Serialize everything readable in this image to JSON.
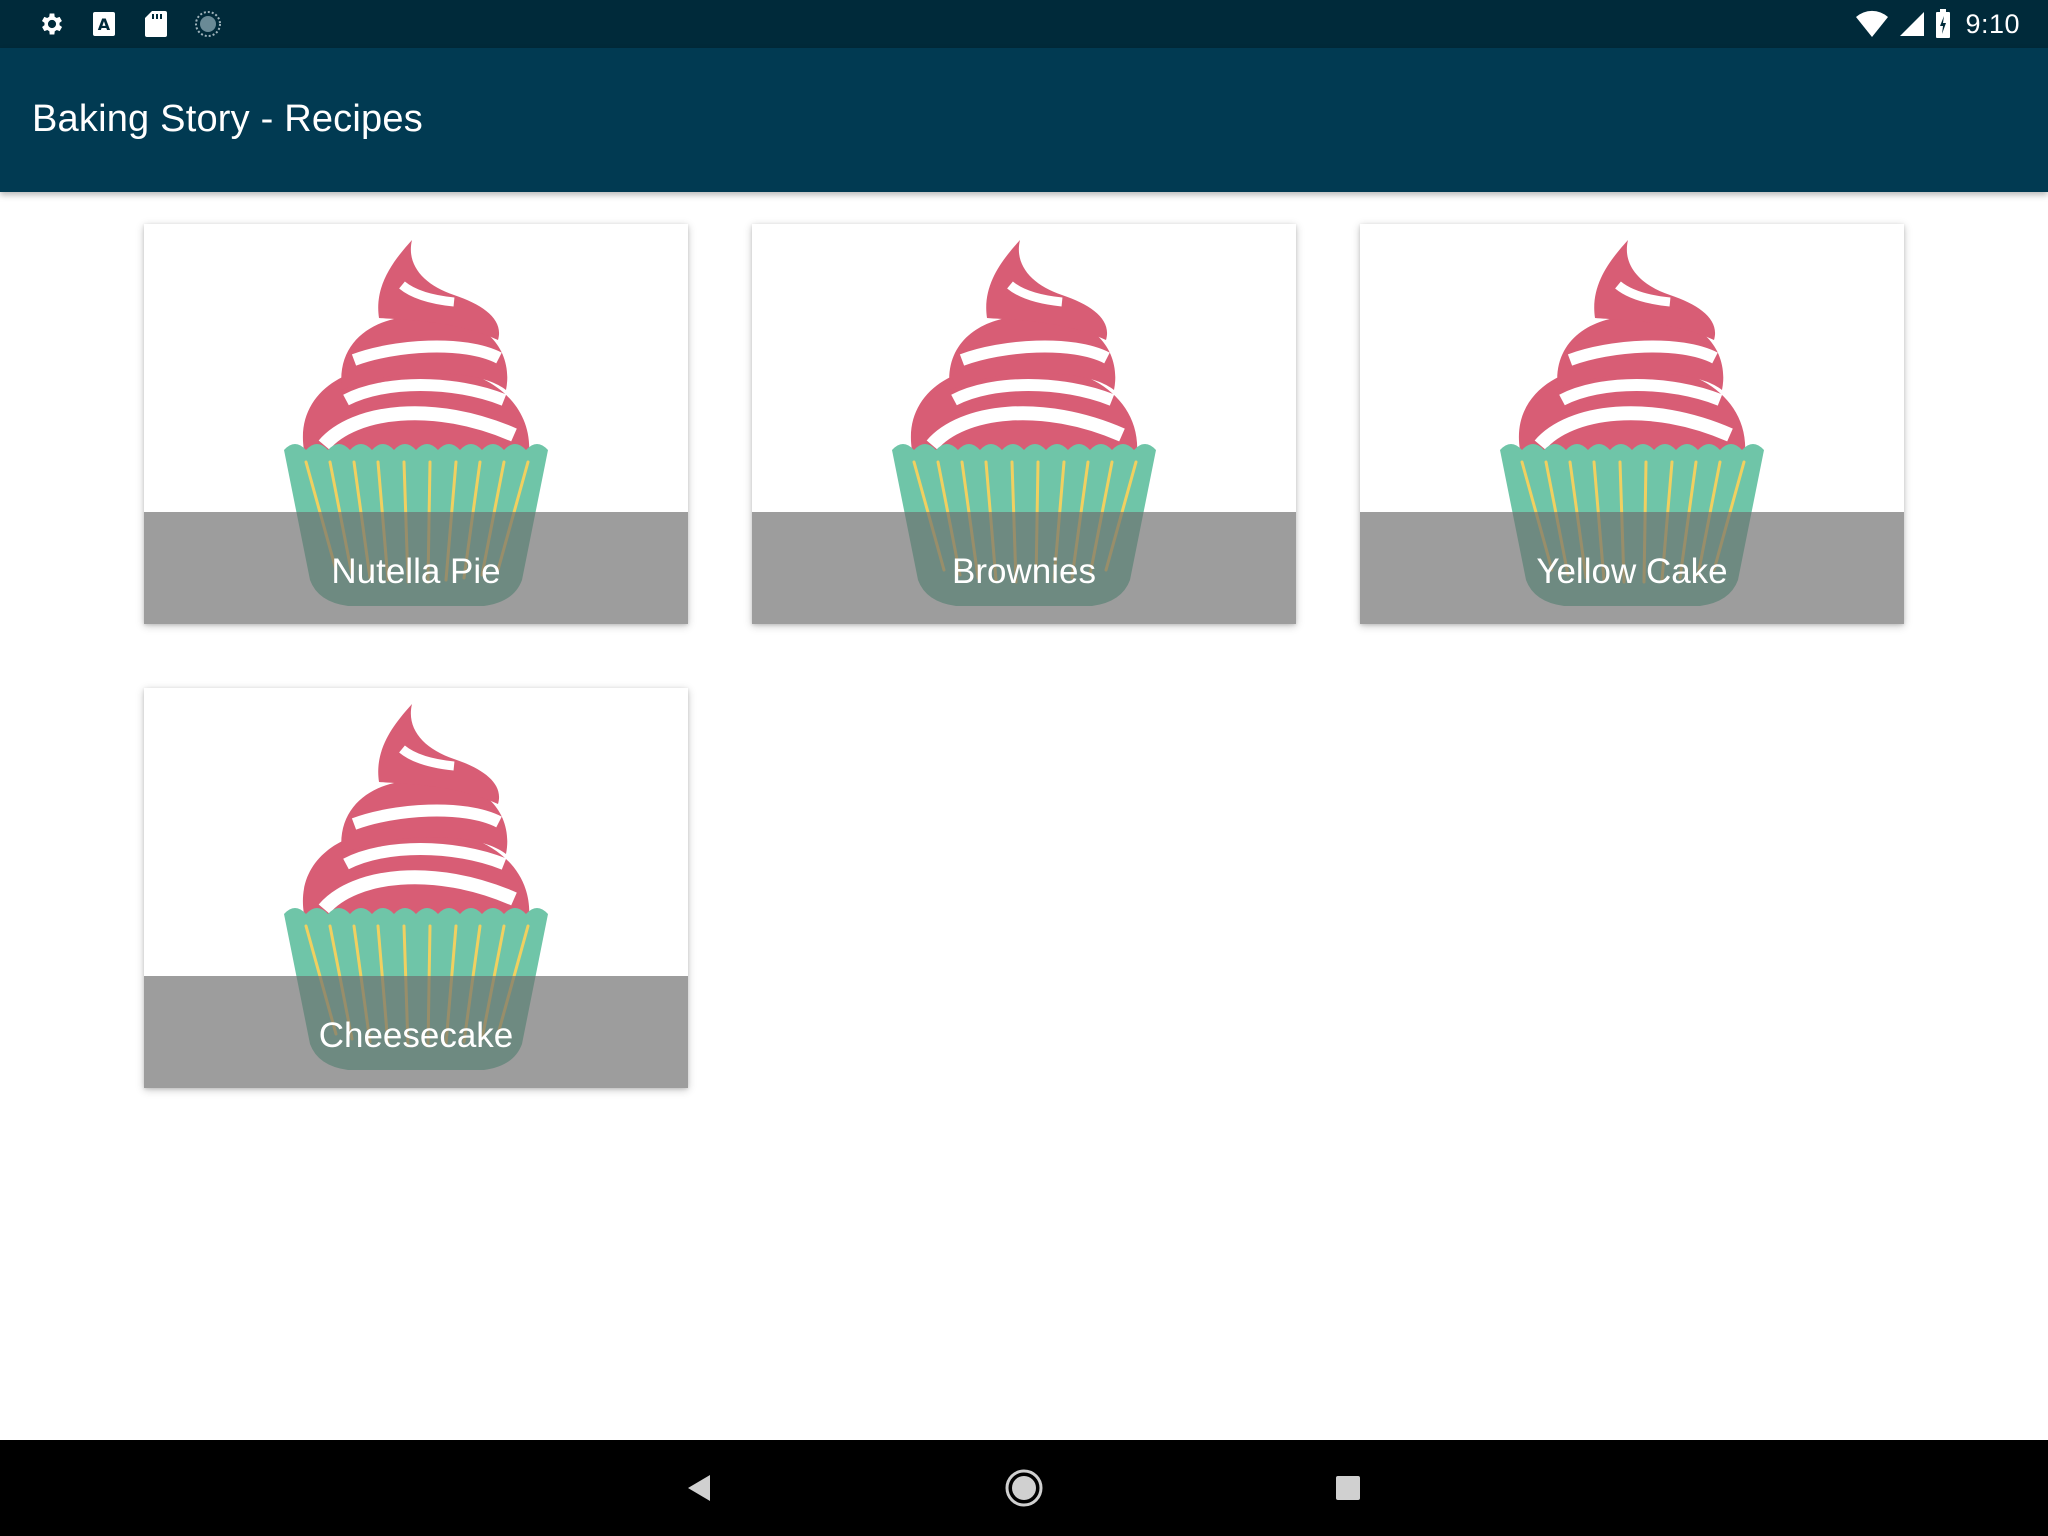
{
  "status_bar": {
    "time": "9:10",
    "left_icons": [
      "settings-icon",
      "keyboard-a-icon",
      "sd-card-icon",
      "sync-circle-icon"
    ],
    "right_icons": [
      "wifi-icon",
      "cell-signal-icon",
      "battery-charging-icon"
    ]
  },
  "app_bar": {
    "title": "Baking Story - Recipes"
  },
  "recipes": [
    {
      "name": "Nutella Pie",
      "icon": "cupcake-icon"
    },
    {
      "name": "Brownies",
      "icon": "cupcake-icon"
    },
    {
      "name": "Yellow Cake",
      "icon": "cupcake-icon"
    },
    {
      "name": "Cheesecake",
      "icon": "cupcake-icon"
    }
  ],
  "colors": {
    "status_bar": "#002a3a",
    "app_bar": "#013a52",
    "frosting": "#d85d75",
    "liner": "#6fc5a8",
    "liner_stripes": "#f0d060",
    "label_overlay": "#6e6e6e"
  },
  "nav_bar": {
    "buttons": [
      "back-icon",
      "home-icon",
      "recents-icon"
    ]
  }
}
